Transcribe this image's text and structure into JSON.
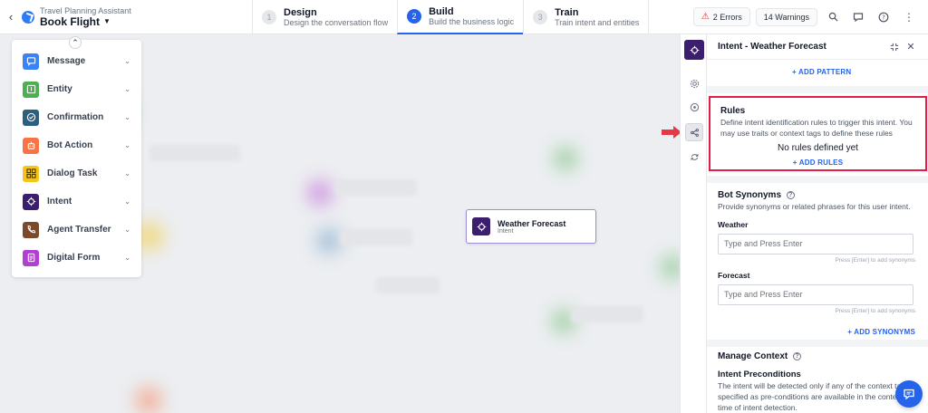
{
  "header": {
    "project_subtitle": "Travel Planning Assistant",
    "project_title": "Book Flight",
    "steps": [
      {
        "num": "1",
        "label": "Design",
        "desc": "Design the conversation flow"
      },
      {
        "num": "2",
        "label": "Build",
        "desc": "Build the business logic"
      },
      {
        "num": "3",
        "label": "Train",
        "desc": "Train intent and entities"
      }
    ],
    "errors": "2 Errors",
    "warnings": "14 Warnings"
  },
  "palette": {
    "items": [
      {
        "label": "Message",
        "icon": "message-icon",
        "color": "#3b82f6"
      },
      {
        "label": "Entity",
        "icon": "entity-icon",
        "color": "#4caf50"
      },
      {
        "label": "Confirmation",
        "icon": "confirmation-icon",
        "color": "#2e5e7e"
      },
      {
        "label": "Bot Action",
        "icon": "bot-action-icon",
        "color": "#f97345"
      },
      {
        "label": "Dialog Task",
        "icon": "dialog-task-icon",
        "color": "#f5c518"
      },
      {
        "label": "Intent",
        "icon": "intent-icon",
        "color": "#3b1f6e"
      },
      {
        "label": "Agent Transfer",
        "icon": "agent-transfer-icon",
        "color": "#7a4a2a"
      },
      {
        "label": "Digital Form",
        "icon": "digital-form-icon",
        "color": "#b13fd1"
      }
    ]
  },
  "canvas": {
    "node": {
      "title": "Weather Forecast",
      "subtitle": "Intent"
    }
  },
  "panel": {
    "title": "Intent - Weather Forecast",
    "add_pattern": "+ ADD PATTERN",
    "rules": {
      "title": "Rules",
      "description": "Define intent identification rules to trigger this intent. You may use traits or context tags to define these rules",
      "empty": "No rules defined yet",
      "add": "+ ADD RULES"
    },
    "synonyms": {
      "title": "Bot Synonyms",
      "description": "Provide synonyms or related phrases for this user intent.",
      "fields": [
        {
          "label": "Weather",
          "placeholder": "Type and Press Enter",
          "hint": "Press [Enter] to add synonyms"
        },
        {
          "label": "Forecast",
          "placeholder": "Type and Press Enter",
          "hint": "Press [Enter] to add synonyms"
        }
      ],
      "add": "+ ADD SYNONYMS"
    },
    "context": {
      "title": "Manage Context",
      "subtitle": "Intent Preconditions",
      "description": "The intent will be detected only if any of the context tags specified as pre-conditions are available in the context at time of intent detection."
    }
  }
}
